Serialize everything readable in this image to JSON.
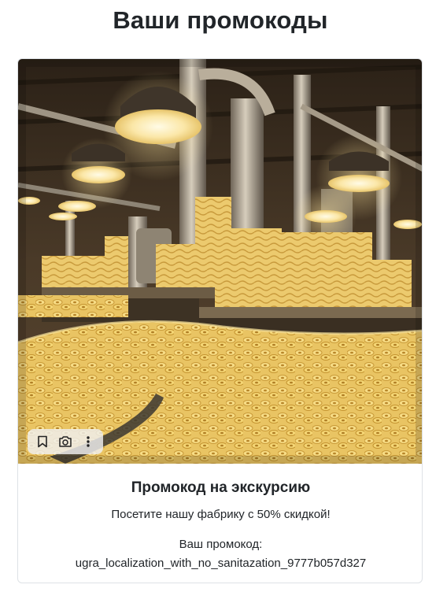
{
  "page": {
    "title": "Ваши промокоды"
  },
  "promo_card": {
    "image_alt": "Макаронная фабрика",
    "toolbar": {
      "bookmark_icon": "bookmark-icon",
      "camera_icon": "camera-search-icon",
      "more_icon": "more-vertical-icon"
    },
    "title": "Промокод на экскурсию",
    "description": "Посетите нашу фабрику с 50% скидкой!",
    "code_label": "Ваш промокод:",
    "code_value": "ugra_localization_with_no_sanitazation_9777b057d327"
  },
  "colors": {
    "text": "#212529",
    "border": "#dee2e6",
    "pasta": "#f1d27a",
    "factory_bg": "#3a2c1e"
  }
}
